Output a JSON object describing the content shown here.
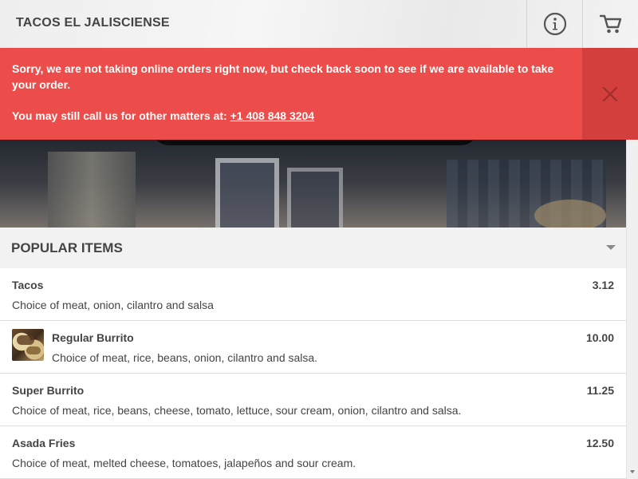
{
  "header": {
    "brand": "TACOS EL JALISCIENSE",
    "info_icon": "info-icon",
    "cart_icon": "cart-icon"
  },
  "alert": {
    "message": "Sorry, we are not taking online orders right now, but check back soon to see if we are available to take your order.",
    "call_prefix": "You may still call us for other matters at: ",
    "phone": "+1 408 848 3204",
    "close_icon": "close-icon"
  },
  "section": {
    "title": "POPULAR ITEMS",
    "toggle_icon": "caret-down-icon"
  },
  "menu_items": [
    {
      "name": "Tacos",
      "description": "Choice of meat, onion, cilantro and salsa",
      "price": "3.12",
      "has_image": false
    },
    {
      "name": "Regular Burrito",
      "description": "Choice of meat, rice, beans, onion, cilantro and salsa.",
      "price": "10.00",
      "has_image": true
    },
    {
      "name": "Super Burrito",
      "description": "Choice of meat, rice, beans, cheese, tomato, lettuce, sour cream, onion, cilantro and salsa.",
      "price": "11.25",
      "has_image": false
    },
    {
      "name": "Asada Fries",
      "description": "Choice of meat, melted cheese, tomatoes, jalapeños and sour cream.",
      "price": "12.50",
      "has_image": false
    }
  ],
  "colors": {
    "alert_bg": "#ec4d4a",
    "alert_close_bg": "#d33f3d",
    "text": "#444444"
  }
}
